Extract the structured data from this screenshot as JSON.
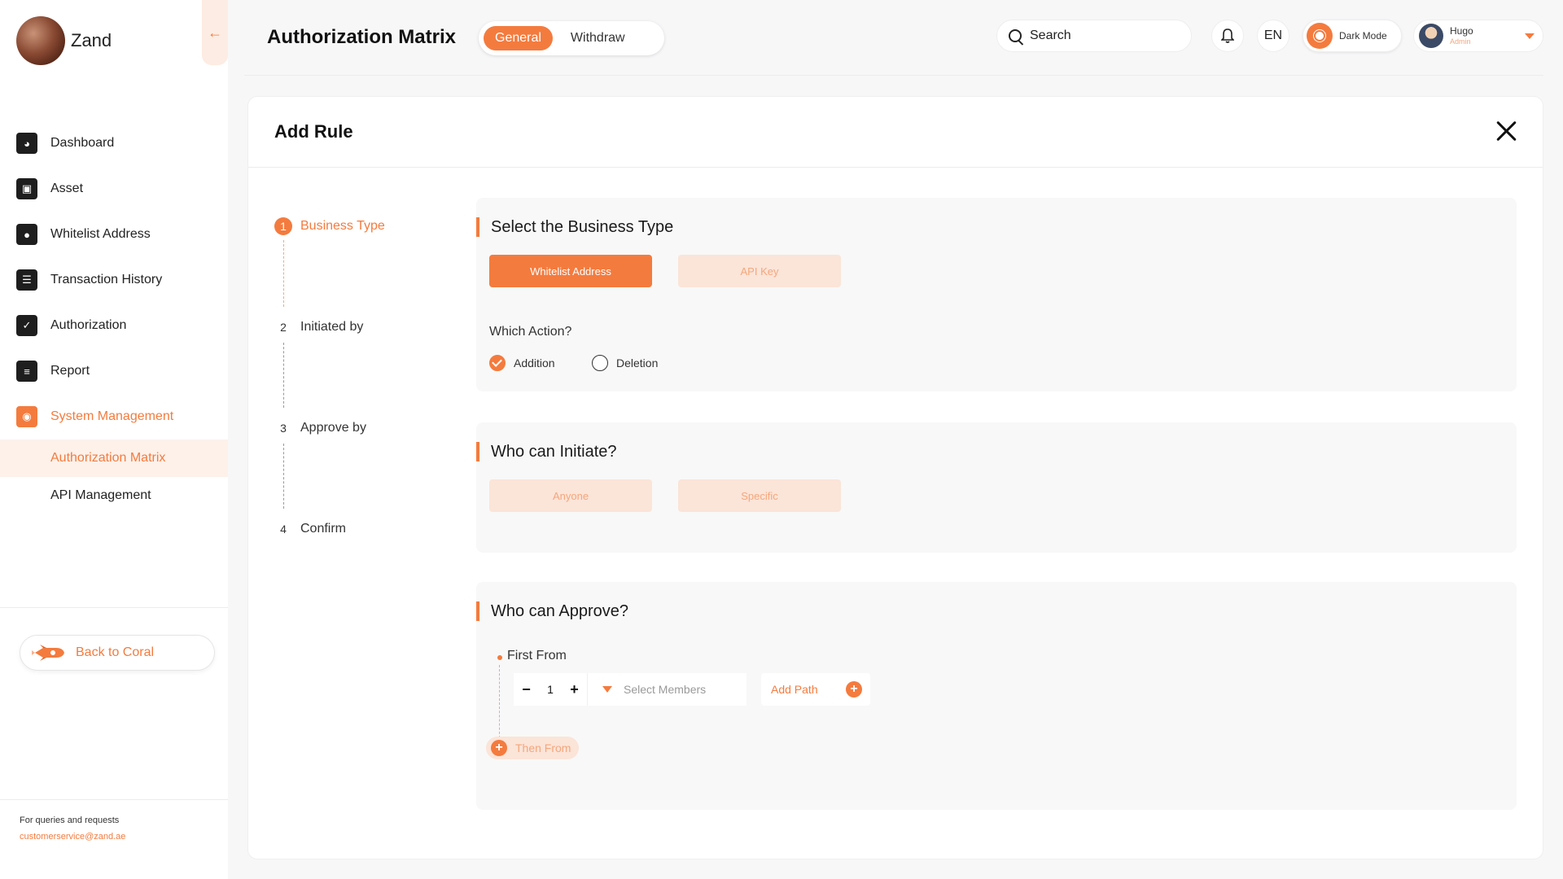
{
  "brand": {
    "name": "Zand"
  },
  "sidebar": {
    "items": [
      {
        "label": "Dashboard",
        "icon": "dashboard-icon"
      },
      {
        "label": "Asset",
        "icon": "wallet-icon"
      },
      {
        "label": "Whitelist Address",
        "icon": "location-book-icon"
      },
      {
        "label": "Transaction History",
        "icon": "list-icon"
      },
      {
        "label": "Authorization",
        "icon": "check-calendar-icon"
      },
      {
        "label": "Report",
        "icon": "report-icon"
      },
      {
        "label": "System Management",
        "icon": "system-icon",
        "active": true
      }
    ],
    "sub_items": [
      {
        "label": "Authorization Matrix",
        "active": true
      },
      {
        "label": "API Management"
      }
    ],
    "back_label": "Back to Coral",
    "footer_text": "For queries and requests",
    "footer_email": "customerservice@zand.ae"
  },
  "header": {
    "title": "Authorization Matrix",
    "tabs": [
      {
        "label": "General",
        "active": true
      },
      {
        "label": "Withdraw"
      }
    ],
    "search_label": "Search",
    "language": "EN",
    "dark_mode_label": "Dark Mode",
    "user": {
      "name": "Hugo",
      "role": "Admin"
    }
  },
  "modal": {
    "title": "Add Rule",
    "steps": [
      {
        "num": "1",
        "label": "Business Type",
        "active": true
      },
      {
        "num": "2",
        "label": "Initiated by"
      },
      {
        "num": "3",
        "label": "Approve by"
      },
      {
        "num": "4",
        "label": "Confirm"
      }
    ],
    "business": {
      "title": "Select the Business Type",
      "options": [
        {
          "label": "Whitelist Address",
          "selected": true
        },
        {
          "label": "API Key"
        }
      ],
      "action_question": "Which Action?",
      "actions": [
        {
          "label": "Addition",
          "checked": true
        },
        {
          "label": "Deletion"
        }
      ]
    },
    "initiate": {
      "title": "Who can Initiate?",
      "options": [
        {
          "label": "Anyone"
        },
        {
          "label": "Specific"
        }
      ]
    },
    "approve": {
      "title": "Who can Approve?",
      "first_from": "First From",
      "count": "1",
      "members_placeholder": "Select Members",
      "add_path": "Add Path",
      "then_from": "Then From"
    }
  },
  "colors": {
    "accent": "#f47b3e",
    "accent_light": "#fbe4d8"
  }
}
